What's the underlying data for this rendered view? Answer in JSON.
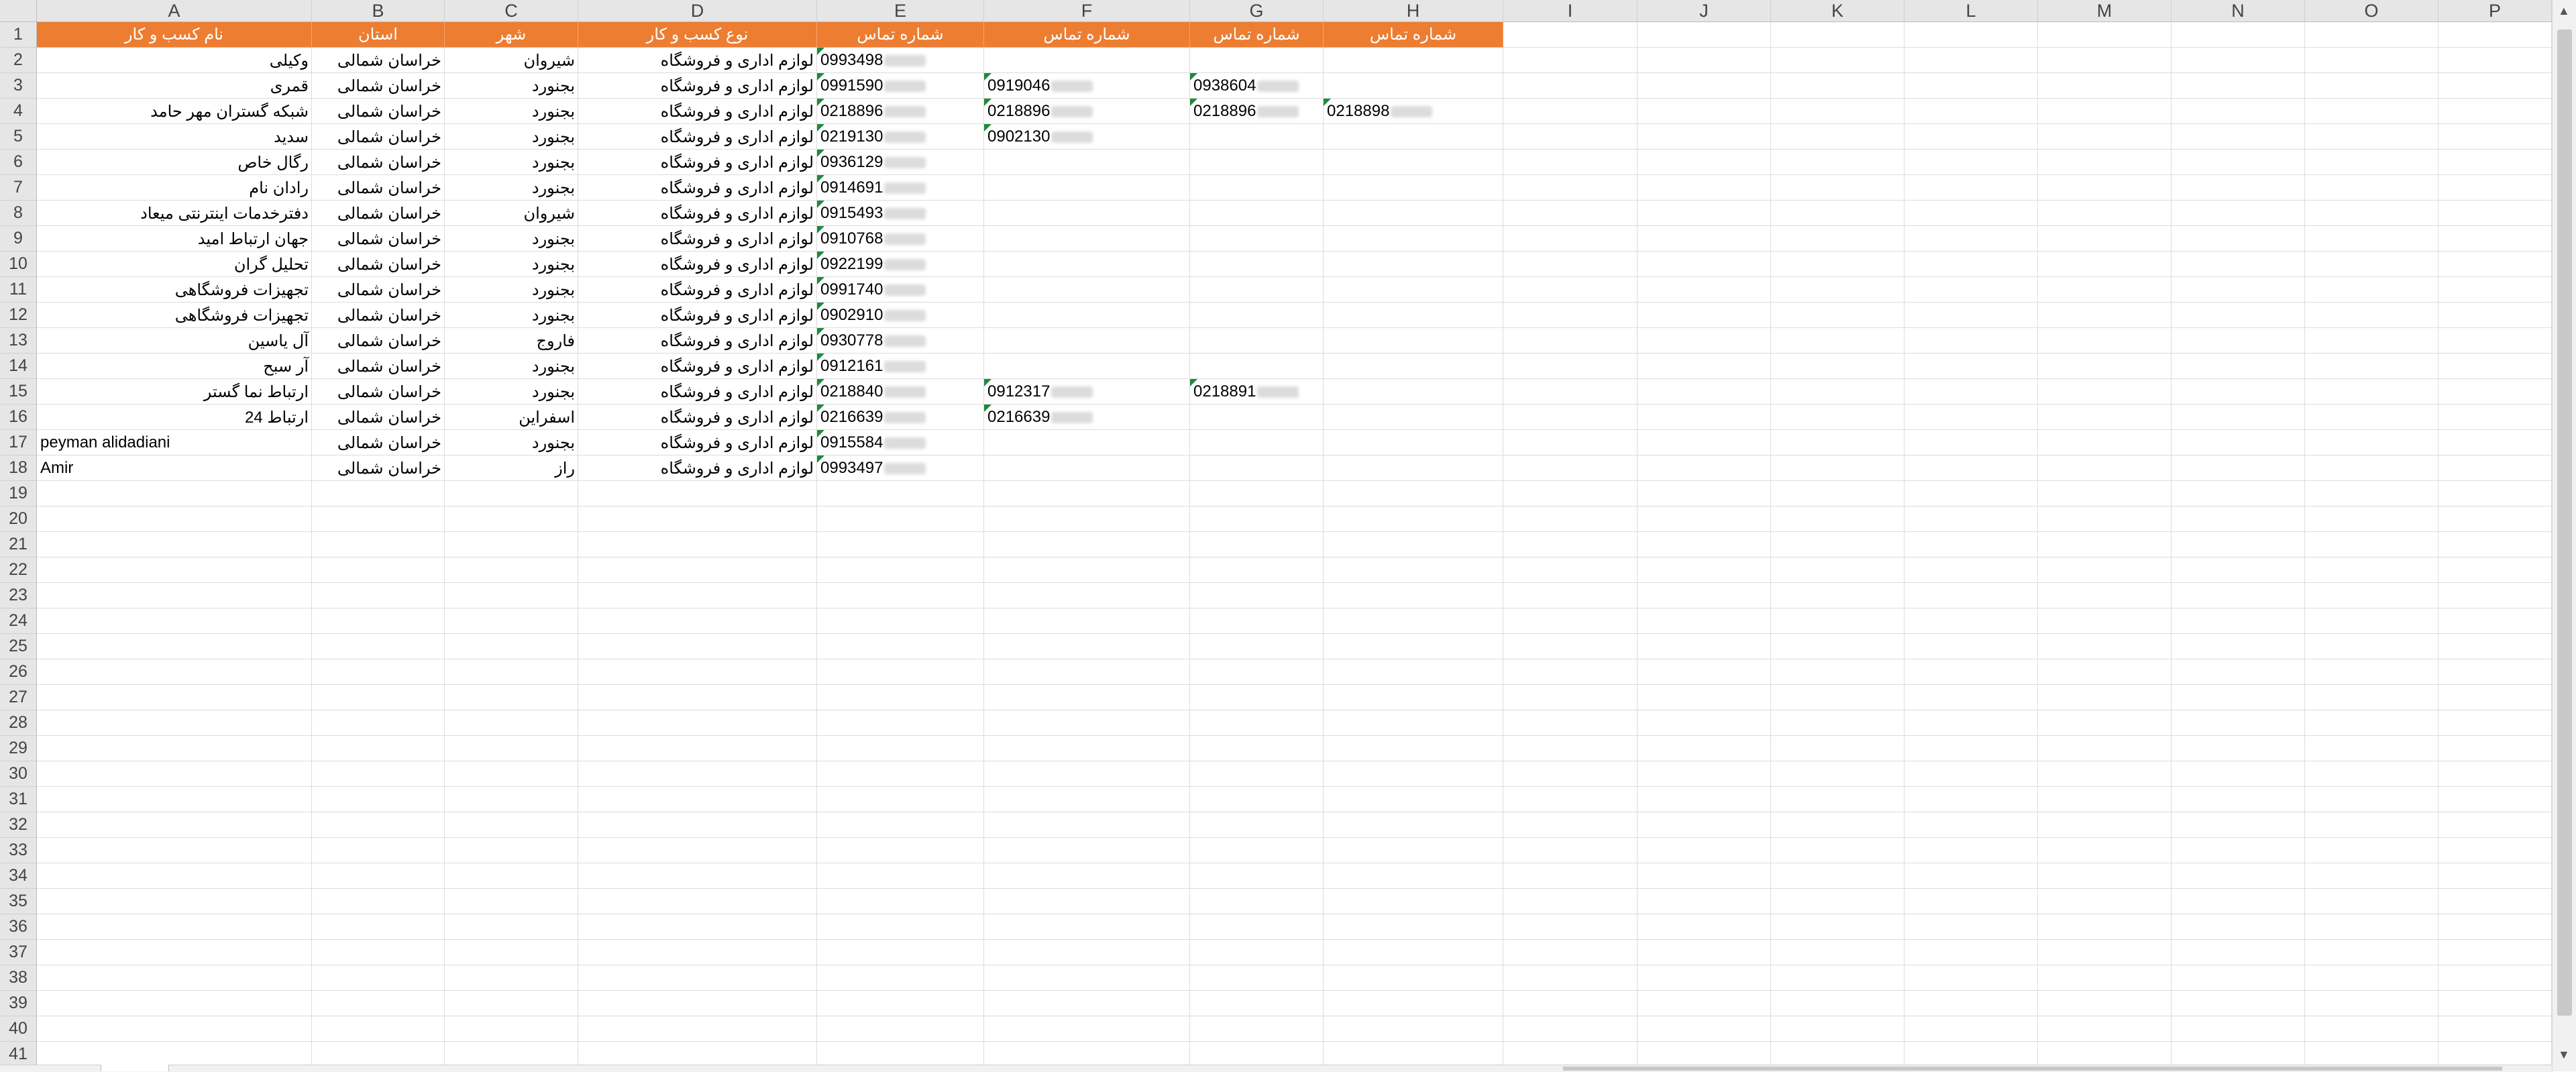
{
  "spreadsheet": {
    "columns": [
      "A",
      "B",
      "C",
      "D",
      "E",
      "F",
      "G",
      "H",
      "I",
      "J",
      "K",
      "L",
      "M",
      "N",
      "O",
      "P"
    ],
    "row_numbers": [
      "1",
      "2",
      "3",
      "4",
      "5",
      "6",
      "7",
      "8",
      "9",
      "10",
      "11",
      "12",
      "13",
      "14",
      "15",
      "16",
      "17",
      "18",
      "19",
      "20",
      "21",
      "22",
      "23",
      "24",
      "25",
      "26",
      "27",
      "28",
      "29",
      "30",
      "31",
      "32",
      "33",
      "34",
      "35",
      "36",
      "37",
      "38",
      "39",
      "40",
      "41"
    ],
    "header_row": [
      "نام کسب و کار",
      "استان",
      "شهر",
      "نوع کسب و کار",
      "شماره تماس",
      "شماره تماس",
      "شماره تماس",
      "شماره تماس"
    ],
    "header_color": "#ed7d31",
    "rows": [
      {
        "name": "وکیلی",
        "province": "خراسان شمالی",
        "city": "شیروان",
        "type": "لوازم اداری و فروشگاه",
        "phones": [
          "0993498",
          "",
          "",
          ""
        ]
      },
      {
        "name": "قمری",
        "province": "خراسان شمالی",
        "city": "بجنورد",
        "type": "لوازم اداری و فروشگاه",
        "phones": [
          "0991590",
          "0919046",
          "0938604",
          ""
        ]
      },
      {
        "name": "شبکه گستران مهر حامد",
        "province": "خراسان شمالی",
        "city": "بجنورد",
        "type": "لوازم اداری و فروشگاه",
        "phones": [
          "0218896",
          "0218896",
          "0218896",
          "0218898"
        ]
      },
      {
        "name": "سدید",
        "province": "خراسان شمالی",
        "city": "بجنورد",
        "type": "لوازم اداری و فروشگاه",
        "phones": [
          "0219130",
          "0902130",
          "",
          ""
        ]
      },
      {
        "name": "رگال خاص",
        "province": "خراسان شمالی",
        "city": "بجنورد",
        "type": "لوازم اداری و فروشگاه",
        "phones": [
          "0936129",
          "",
          "",
          ""
        ]
      },
      {
        "name": "رادان نام",
        "province": "خراسان شمالی",
        "city": "بجنورد",
        "type": "لوازم اداری و فروشگاه",
        "phones": [
          "0914691",
          "",
          "",
          ""
        ]
      },
      {
        "name": "دفترخدمات اینترنتی میعاد",
        "province": "خراسان شمالی",
        "city": "شیروان",
        "type": "لوازم اداری و فروشگاه",
        "phones": [
          "0915493",
          "",
          "",
          ""
        ]
      },
      {
        "name": "جهان ارتباط امید",
        "province": "خراسان شمالی",
        "city": "بجنورد",
        "type": "لوازم اداری و فروشگاه",
        "phones": [
          "0910768",
          "",
          "",
          ""
        ]
      },
      {
        "name": "تحلیل گران",
        "province": "خراسان شمالی",
        "city": "بجنورد",
        "type": "لوازم اداری و فروشگاه",
        "phones": [
          "0922199",
          "",
          "",
          ""
        ]
      },
      {
        "name": "تجهیزات فروشگاهی",
        "province": "خراسان شمالی",
        "city": "بجنورد",
        "type": "لوازم اداری و فروشگاه",
        "phones": [
          "0991740",
          "",
          "",
          ""
        ]
      },
      {
        "name": "تجهیزات فروشگاهی",
        "province": "خراسان شمالی",
        "city": "بجنورد",
        "type": "لوازم اداری و فروشگاه",
        "phones": [
          "0902910",
          "",
          "",
          ""
        ]
      },
      {
        "name": "آل یاسین",
        "province": "خراسان شمالی",
        "city": "فاروج",
        "type": "لوازم اداری و فروشگاه",
        "phones": [
          "0930778",
          "",
          "",
          ""
        ]
      },
      {
        "name": "آر سبح",
        "province": "خراسان شمالی",
        "city": "بجنورد",
        "type": "لوازم اداری و فروشگاه",
        "phones": [
          "0912161",
          "",
          "",
          ""
        ]
      },
      {
        "name": "ارتباط نما گستر",
        "province": "خراسان شمالی",
        "city": "بجنورد",
        "type": "لوازم اداری و فروشگاه",
        "phones": [
          "0218840",
          "0912317",
          "0218891",
          ""
        ]
      },
      {
        "name": "ارتباط 24",
        "province": "خراسان شمالی",
        "city": "اسفراین",
        "type": "لوازم اداری و فروشگاه",
        "phones": [
          "0216639",
          "0216639",
          "",
          ""
        ]
      },
      {
        "name": "peyman alidadiani",
        "province": "خراسان شمالی",
        "city": "بجنورد",
        "type": "لوازم اداری و فروشگاه",
        "phones": [
          "0915584",
          "",
          "",
          ""
        ]
      },
      {
        "name": "Amir",
        "province": "خراسان شمالی",
        "city": "راز",
        "type": "لوازم اداری و فروشگاه",
        "phones": [
          "0993497",
          "",
          "",
          ""
        ]
      }
    ]
  }
}
